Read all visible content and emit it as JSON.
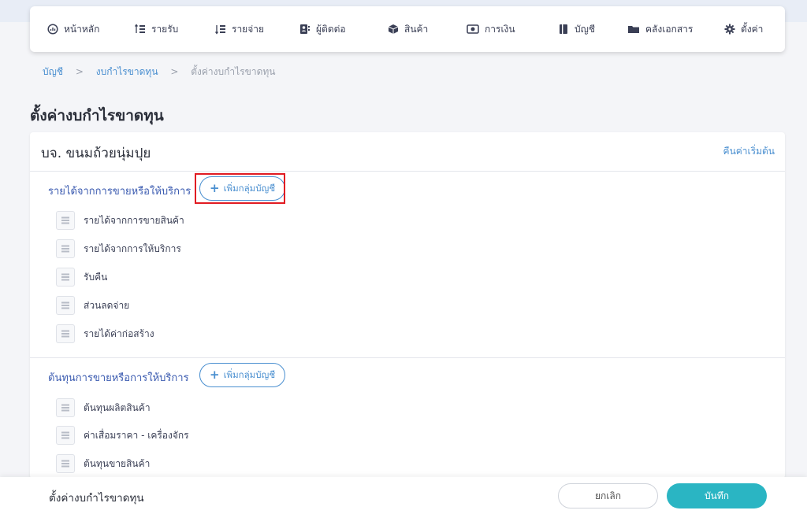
{
  "nav": {
    "items": [
      {
        "label": "หน้าหลัก",
        "icon": "dashboard-icon"
      },
      {
        "label": "รายรับ",
        "icon": "income-icon"
      },
      {
        "label": "รายจ่าย",
        "icon": "expense-icon"
      },
      {
        "label": "ผู้ติดต่อ",
        "icon": "contacts-icon"
      },
      {
        "label": "สินค้า",
        "icon": "product-box-icon"
      },
      {
        "label": "การเงิน",
        "icon": "money-icon"
      },
      {
        "label": "บัญชี",
        "icon": "ledger-book-icon"
      },
      {
        "label": "คลังเอกสาร",
        "icon": "folder-icon"
      },
      {
        "label": "ตั้งค่า",
        "icon": "gear-icon"
      }
    ]
  },
  "breadcrumb": {
    "items": [
      "บัญชี",
      "งบกำไรขาดทุน",
      "ตั้งค่างบกำไรขาดทุน"
    ],
    "separator": ">"
  },
  "page": {
    "title": "ตั้งค่างบกำไรขาดทุน"
  },
  "card": {
    "company": "บจ. ขนมถ้วยนุ่มปุย",
    "reset_label": "คืนค่าเริ่มต้น",
    "sections": [
      {
        "title": "รายได้จากการขายหรือให้บริการ",
        "add_label": "เพิ่มกลุ่มบัญชี",
        "accounts": [
          "รายได้จากการขายสินค้า",
          "รายได้จากการให้บริการ",
          "รับคืน",
          "ส่วนลดจ่าย",
          "รายได้ค่าก่อสร้าง"
        ]
      },
      {
        "title": "ต้นทุนการขายหรือการให้บริการ",
        "add_label": "เพิ่มกลุ่มบัญชี",
        "accounts": [
          "ต้นทุนผลิตสินค้า",
          "ค่าเสื่อมราคา - เครื่องจักร",
          "ต้นทุนขายสินค้า"
        ]
      }
    ]
  },
  "footer": {
    "title": "ตั้งค่างบกำไรขาดทุน",
    "cancel_label": "ยกเลิก",
    "save_label": "บันทึก"
  },
  "colors": {
    "accent": "#4a8fd0",
    "section_title": "#3b5bb0",
    "save_button": "#2ab5c3",
    "highlight": "#e11b22"
  }
}
